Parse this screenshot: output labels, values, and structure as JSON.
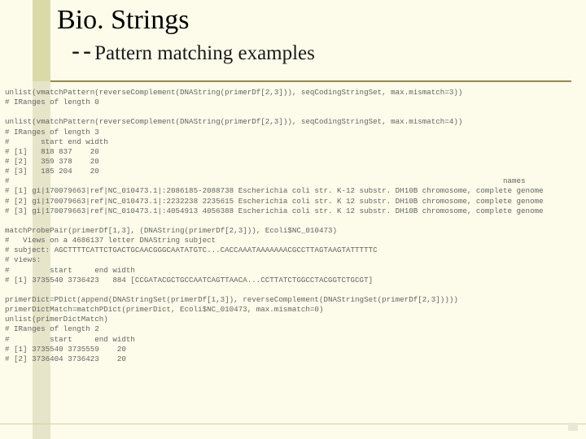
{
  "title": "Bio. Strings",
  "subtitle_prefix": "--",
  "subtitle": "Pattern matching examples",
  "code_lines": [
    "unlist(vmatchPattern(reverseComplement(DNAString(primerDf[2,3])), seqCodingStringSet, max.mismatch=3))",
    "# IRanges of length 0",
    "",
    "unlist(vmatchPattern(reverseComplement(DNAString(primerDf[2,3])), seqCodingStringSet, max.mismatch=4))",
    "# IRanges of length 3",
    "#       start end width",
    "# [1]   818 837    20",
    "# [2]   359 378    20",
    "# [3]   185 204    20",
    "#                                                                                                              names",
    "# [1] gi|170079663|ref|NC_010473.1|:2086185-2088738 Escherichia coli str. K-12 substr. DH10B chromosome, complete genome",
    "# [2] gi|170079663|ref|NC_010473.1|:2232238 2235615 Escherichia coli str. K 12 substr. DH10B chromosome, complete genome",
    "# [3] gi|170079663|ref|NC_010473.1|:4054913 4056388 Escherichia coli str. K 12 substr. DH10B chromosome, complete genome",
    "",
    "matchProbePair(primerDf[1,3], (DNAString(primerDf[2,3])), Ecoli$NC_010473)",
    "#   Views on a 4686137 letter DNAString subject",
    "# subject: AGCTTTTCATTCTGACTGCAACGGGCAATATGTC...CACCAAATAAAAAAACGCCTTAGTAAGTATTTTTC",
    "# views:",
    "#         start     end width",
    "# [1] 3735540 3736423   884 [CCGATACGCTGCCAATCAGTTAACA...CCTTATCTGGCCTACGGTCTGCGT]",
    "",
    "primerDict=PDict(append(DNAStringSet(primerDf[1,3]), reverseComplement(DNAStringSet(primerDf[2,3]))))",
    "primerDictMatch=matchPDict(primerDict, Ecoli$NC_010473, max.mismatch=0)",
    "unlist(primerDictMatch)",
    "# IRanges of length 2",
    "#         start     end width",
    "# [1] 3735540 3735559    20",
    "# [2] 3736404 3736423    20"
  ]
}
